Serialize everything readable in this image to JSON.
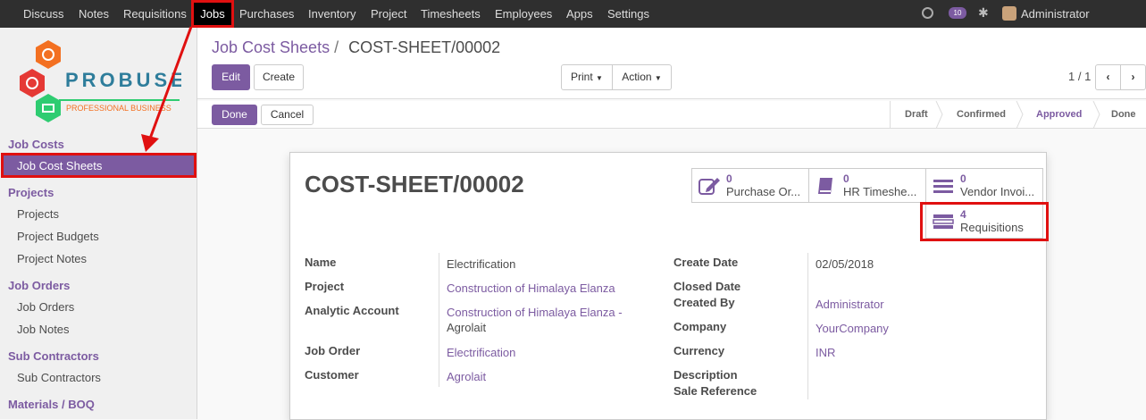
{
  "topbar": {
    "menu": [
      "Discuss",
      "Notes",
      "Requisitions",
      "Jobs",
      "Purchases",
      "Inventory",
      "Project",
      "Timesheets",
      "Employees",
      "Apps",
      "Settings"
    ],
    "active": "Jobs",
    "chat_count": "10",
    "user": "Administrator (material..."
  },
  "logo": {
    "name": "PROBUSE",
    "tagline": "PROFESSIONAL BUSINESS"
  },
  "sidebar": {
    "groups": [
      {
        "title": "Job Costs",
        "items": [
          "Job Cost Sheets"
        ]
      },
      {
        "title": "Projects",
        "items": [
          "Projects",
          "Project Budgets",
          "Project Notes"
        ]
      },
      {
        "title": "Job Orders",
        "items": [
          "Job Orders",
          "Job Notes"
        ]
      },
      {
        "title": "Sub Contractors",
        "items": [
          "Sub Contractors"
        ]
      },
      {
        "title": "Materials / BOQ",
        "items": []
      }
    ],
    "active_item": "Job Cost Sheets"
  },
  "breadcrumb": {
    "parent": "Job Cost Sheets",
    "separator": "/",
    "current": "COST-SHEET/00002"
  },
  "toolbar": {
    "edit": "Edit",
    "create": "Create",
    "print": "Print",
    "action": "Action",
    "pager": "1 / 1"
  },
  "statusbar": {
    "done": "Done",
    "cancel": "Cancel",
    "steps": [
      "Draft",
      "Confirmed",
      "Approved",
      "Done"
    ],
    "current": "Approved"
  },
  "sheet": {
    "title": "COST-SHEET/00002",
    "smart_buttons": [
      {
        "count": "0",
        "label": "Purchase Or...",
        "icon": "pencil-square-icon"
      },
      {
        "count": "0",
        "label": "HR Timeshe...",
        "icon": "book-icon"
      },
      {
        "count": "0",
        "label": "Vendor Invoi...",
        "icon": "list-icon"
      },
      {
        "count": "4",
        "label": "Requisitions",
        "icon": "tasks-icon"
      }
    ],
    "fields_left": [
      {
        "label": "Name",
        "value": "Electrification",
        "link": false
      },
      {
        "label": "Project",
        "value": "Construction of Himalaya Elanza",
        "link": true
      },
      {
        "label": "Analytic Account",
        "value": "Construction of Himalaya Elanza -",
        "value2": "Agrolait",
        "link": true
      },
      {
        "label": "Job Order",
        "value": "Electrification",
        "link": true
      },
      {
        "label": "Customer",
        "value": "Agrolait",
        "link": true
      }
    ],
    "fields_right": [
      {
        "label": "Create Date",
        "value": "02/05/2018",
        "link": false
      },
      {
        "label": "Closed Date",
        "value": "",
        "link": false
      },
      {
        "label": "Created By",
        "value": "Administrator",
        "link": true
      },
      {
        "label": "Company",
        "value": "YourCompany",
        "link": true
      },
      {
        "label": "Currency",
        "value": "INR",
        "link": true
      },
      {
        "label": "Description",
        "value": "",
        "link": false
      },
      {
        "label": "Sale Reference",
        "value": "",
        "link": false
      }
    ]
  }
}
